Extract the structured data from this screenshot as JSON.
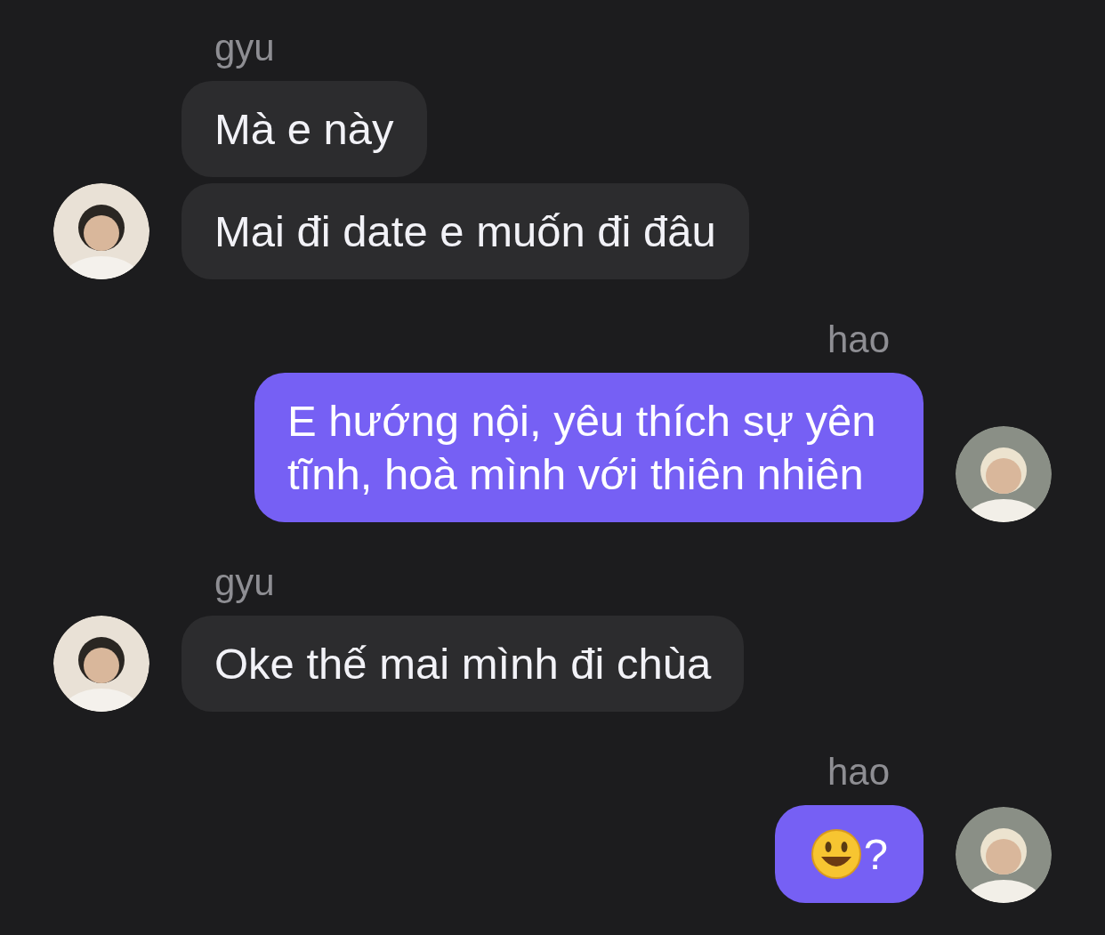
{
  "groups": [
    {
      "sender": "gyu",
      "kind": "received",
      "messages": [
        {
          "kind": "text",
          "text": "Mà e này"
        },
        {
          "kind": "text",
          "text": "Mai đi date e muốn đi đâu"
        }
      ]
    },
    {
      "sender": "hao",
      "kind": "sent",
      "messages": [
        {
          "kind": "text",
          "text": "E hướng nội, yêu thích sự yên tĩnh, hoà mình với thiên nhiên"
        }
      ]
    },
    {
      "sender": "gyu",
      "kind": "received",
      "messages": [
        {
          "kind": "text",
          "text": "Oke thế mai mình đi chùa"
        }
      ]
    },
    {
      "sender": "hao",
      "kind": "sent",
      "messages": [
        {
          "kind": "emoji",
          "text": "?"
        }
      ]
    }
  ]
}
